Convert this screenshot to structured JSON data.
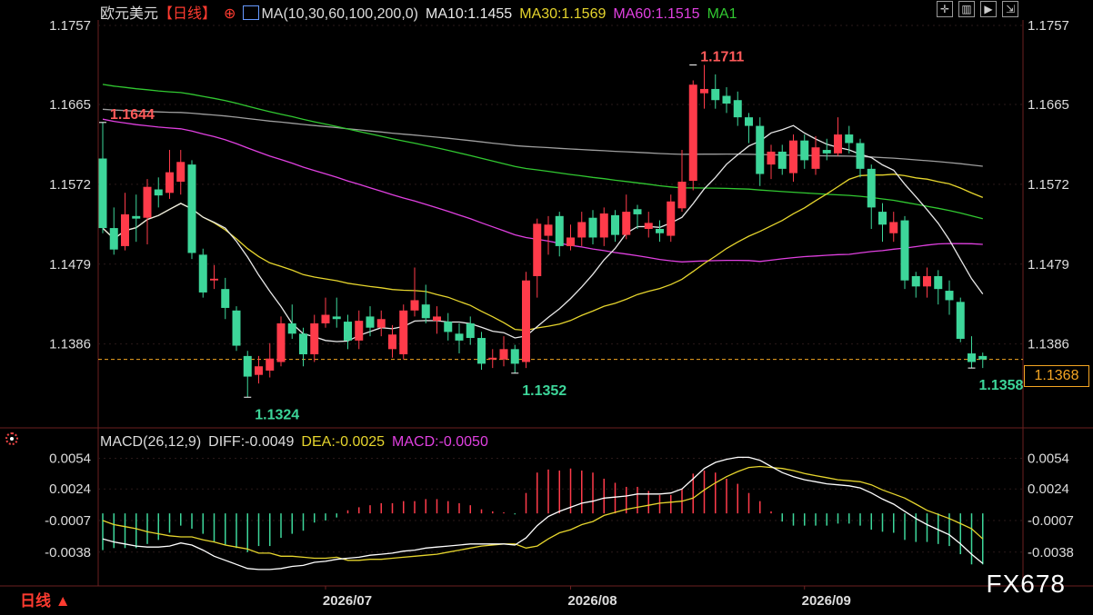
{
  "header": {
    "symbol": "欧元美元",
    "period": "【日线】",
    "add_icon": "⊕",
    "ma_params": "MA(10,30,60,100,200,0)",
    "ma10": "MA10:1.1455",
    "ma30": "MA30:1.1569",
    "ma60": "MA60:1.1515",
    "ma100": "MA1"
  },
  "macd_header": {
    "params": "MACD(26,12,9)",
    "diff": "DIFF:-0.0049",
    "dea": "DEA:-0.0025",
    "macd": "MACD:-0.0050"
  },
  "period_button": "日线 ▲",
  "brand": "FX678",
  "current_price_tag": "1.1368",
  "colors": {
    "up": "#ff3b4a",
    "down": "#3dd69a",
    "ma10": "#e8e8e8",
    "ma30": "#e6d52d",
    "ma60": "#e040e0",
    "ma100": "#31c831",
    "ma200": "#9e9e9e",
    "diff": "#ffffff",
    "dea": "#e6d52d",
    "current_line": "#f5a623"
  },
  "chart_data": [
    {
      "type": "candlestick",
      "title": "欧元美元 日线",
      "yticks": [
        "1.1757",
        "1.1665",
        "1.1572",
        "1.1479",
        "1.1386"
      ],
      "ylim": [
        1.13,
        1.1757
      ],
      "xticks": [
        "2026/07",
        "2026/08",
        "2026/09"
      ],
      "current_price": 1.1368,
      "annotations": [
        {
          "label": "1.1644",
          "candle": 0,
          "value": 1.1644,
          "side": "high"
        },
        {
          "label": "1.1324",
          "candle": 13,
          "value": 1.1324,
          "side": "low"
        },
        {
          "label": "1.1352",
          "candle": 37,
          "value": 1.1352,
          "side": "low"
        },
        {
          "label": "1.1711",
          "candle": 53,
          "value": 1.1711,
          "side": "high"
        },
        {
          "label": "1.1358",
          "candle": 78,
          "value": 1.1358,
          "side": "low"
        }
      ],
      "candles": [
        [
          1.1602,
          1.1521,
          1.1644,
          1.1515
        ],
        [
          1.1521,
          1.1496,
          1.1545,
          1.149
        ],
        [
          1.15,
          1.1537,
          1.1562,
          1.1495
        ],
        [
          1.1535,
          1.1532,
          1.156,
          1.1505
        ],
        [
          1.1533,
          1.1569,
          1.1578,
          1.1502
        ],
        [
          1.1566,
          1.1559,
          1.158,
          1.1545
        ],
        [
          1.1562,
          1.1586,
          1.1612,
          1.1555
        ],
        [
          1.1575,
          1.1598,
          1.1612,
          1.156
        ],
        [
          1.1595,
          1.1492,
          1.16,
          1.1485
        ],
        [
          1.149,
          1.1446,
          1.1497,
          1.144
        ],
        [
          1.146,
          1.1462,
          1.1478,
          1.145
        ],
        [
          1.145,
          1.1428,
          1.1463,
          1.1415
        ],
        [
          1.1425,
          1.1384,
          1.143,
          1.1378
        ],
        [
          1.1372,
          1.1348,
          1.1378,
          1.1324
        ],
        [
          1.135,
          1.136,
          1.1372,
          1.134
        ],
        [
          1.1355,
          1.1369,
          1.1387,
          1.1347
        ],
        [
          1.1365,
          1.141,
          1.1418,
          1.136
        ],
        [
          1.141,
          1.1398,
          1.1432,
          1.1392
        ],
        [
          1.1398,
          1.1374,
          1.1405,
          1.136
        ],
        [
          1.1374,
          1.141,
          1.142,
          1.1365
        ],
        [
          1.141,
          1.142,
          1.144,
          1.1405
        ],
        [
          1.1418,
          1.1415,
          1.144,
          1.1405
        ],
        [
          1.1412,
          1.139,
          1.142,
          1.138
        ],
        [
          1.139,
          1.1413,
          1.1425,
          1.138
        ],
        [
          1.1418,
          1.1405,
          1.143,
          1.1395
        ],
        [
          1.1405,
          1.1415,
          1.1425,
          1.1395
        ],
        [
          1.138,
          1.1397,
          1.1408,
          1.137
        ],
        [
          1.1374,
          1.1425,
          1.1432,
          1.1368
        ],
        [
          1.1425,
          1.1437,
          1.1475,
          1.1418
        ],
        [
          1.1432,
          1.1416,
          1.1455,
          1.141
        ],
        [
          1.1413,
          1.1418,
          1.143,
          1.1398
        ],
        [
          1.1412,
          1.14,
          1.1422,
          1.139
        ],
        [
          1.1398,
          1.139,
          1.141,
          1.1375
        ],
        [
          1.141,
          1.1393,
          1.1418,
          1.1385
        ],
        [
          1.1393,
          1.1363,
          1.14,
          1.1356
        ],
        [
          1.1368,
          1.137,
          1.138,
          1.1358
        ],
        [
          1.1368,
          1.138,
          1.1395,
          1.136
        ],
        [
          1.138,
          1.1363,
          1.1385,
          1.1352
        ],
        [
          1.1365,
          1.146,
          1.147,
          1.1358
        ],
        [
          1.1465,
          1.1526,
          1.1532,
          1.144
        ],
        [
          1.1512,
          1.1525,
          1.1535,
          1.149
        ],
        [
          1.1535,
          1.15,
          1.154,
          1.1488
        ],
        [
          1.15,
          1.151,
          1.1525,
          1.1495
        ],
        [
          1.151,
          1.1528,
          1.154,
          1.15
        ],
        [
          1.1533,
          1.151,
          1.1542,
          1.1502
        ],
        [
          1.151,
          1.1538,
          1.1545,
          1.15
        ],
        [
          1.1536,
          1.1513,
          1.1542,
          1.1505
        ],
        [
          1.1513,
          1.154,
          1.156,
          1.1508
        ],
        [
          1.1543,
          1.1537,
          1.1548,
          1.152
        ],
        [
          1.152,
          1.1527,
          1.154,
          1.151
        ],
        [
          1.152,
          1.1515,
          1.153,
          1.1505
        ],
        [
          1.1512,
          1.1552,
          1.156,
          1.1505
        ],
        [
          1.1544,
          1.1575,
          1.1612,
          1.154
        ],
        [
          1.1576,
          1.1688,
          1.1693,
          1.1565
        ],
        [
          1.1678,
          1.1683,
          1.1711,
          1.166
        ],
        [
          1.1683,
          1.167,
          1.17,
          1.166
        ],
        [
          1.1675,
          1.1666,
          1.1685,
          1.1655
        ],
        [
          1.167,
          1.165,
          1.168,
          1.164
        ],
        [
          1.165,
          1.164,
          1.1655,
          1.162
        ],
        [
          1.164,
          1.1584,
          1.165,
          1.157
        ],
        [
          1.1595,
          1.161,
          1.1618,
          1.1578
        ],
        [
          1.161,
          1.159,
          1.1618,
          1.1583
        ],
        [
          1.1585,
          1.1623,
          1.163,
          1.1575
        ],
        [
          1.1623,
          1.16,
          1.163,
          1.159
        ],
        [
          1.159,
          1.1615,
          1.1628,
          1.1583
        ],
        [
          1.1612,
          1.1608,
          1.1625,
          1.16
        ],
        [
          1.1608,
          1.163,
          1.165,
          1.1605
        ],
        [
          1.163,
          1.162,
          1.164,
          1.1608
        ],
        [
          1.162,
          1.159,
          1.1625,
          1.158
        ],
        [
          1.159,
          1.1545,
          1.1595,
          1.152
        ],
        [
          1.154,
          1.1525,
          1.155,
          1.1505
        ],
        [
          1.1515,
          1.1528,
          1.154,
          1.1505
        ],
        [
          1.153,
          1.146,
          1.1535,
          1.145
        ],
        [
          1.1465,
          1.1453,
          1.147,
          1.144
        ],
        [
          1.1453,
          1.1465,
          1.1475,
          1.144
        ],
        [
          1.1465,
          1.145,
          1.1472,
          1.1432
        ],
        [
          1.1448,
          1.1437,
          1.146,
          1.142
        ],
        [
          1.1435,
          1.1392,
          1.144,
          1.1388
        ],
        [
          1.1375,
          1.1365,
          1.1395,
          1.1358
        ],
        [
          1.1372,
          1.1368,
          1.1376,
          1.1358
        ]
      ]
    },
    {
      "type": "bar",
      "title": "MACD(26,12,9)",
      "yticks": [
        "0.0054",
        "0.0024",
        "-0.0007",
        "-0.0038"
      ],
      "ylim": [
        -0.0055,
        0.006
      ],
      "series": [
        {
          "name": "MACD",
          "values": [
            -0.0036,
            -0.0034,
            -0.0034,
            -0.0034,
            -0.003,
            -0.0026,
            -0.0019,
            -0.0012,
            -0.0015,
            -0.002,
            -0.0028,
            -0.0031,
            -0.0034,
            -0.0038,
            -0.0032,
            -0.0032,
            -0.0024,
            -0.002,
            -0.0017,
            -0.0009,
            -0.0007,
            -0.0004,
            0.0003,
            0.0006,
            0.0008,
            0.001,
            0.001,
            0.0012,
            0.0012,
            0.0014,
            0.0014,
            0.0012,
            0.001,
            0.0008,
            0.0004,
            0.0002,
            0.0001,
            -0.0001,
            0.002,
            0.004,
            0.0043,
            0.0042,
            0.0044,
            0.0042,
            0.004,
            0.0034,
            0.003,
            0.0026,
            0.0026,
            0.0022,
            0.0018,
            0.0018,
            0.0024,
            0.0039,
            0.0042,
            0.004,
            0.0034,
            0.0029,
            0.002,
            0.0012,
            0.0002,
            -0.0008,
            -0.0012,
            -0.0012,
            -0.0012,
            -0.0012,
            -0.001,
            -0.001,
            -0.0012,
            -0.0016,
            -0.0018,
            -0.0019,
            -0.0026,
            -0.0028,
            -0.0028,
            -0.003,
            -0.0032,
            -0.004,
            -0.005,
            -0.005
          ]
        },
        {
          "name": "DIFF",
          "values": [
            -0.0025,
            -0.0028,
            -0.003,
            -0.0032,
            -0.0033,
            -0.0033,
            -0.0032,
            -0.0029,
            -0.0031,
            -0.0036,
            -0.0042,
            -0.0046,
            -0.005,
            -0.0054,
            -0.0055,
            -0.0055,
            -0.0054,
            -0.0052,
            -0.0051,
            -0.0048,
            -0.0047,
            -0.0045,
            -0.0044,
            -0.0043,
            -0.0041,
            -0.004,
            -0.0039,
            -0.0037,
            -0.0036,
            -0.0034,
            -0.0033,
            -0.0032,
            -0.0031,
            -0.003,
            -0.003,
            -0.003,
            -0.003,
            -0.0031,
            -0.0024,
            -0.0012,
            -0.0003,
            0.0002,
            0.0006,
            0.001,
            0.0012,
            0.0015,
            0.0016,
            0.0017,
            0.0019,
            0.0019,
            0.0019,
            0.002,
            0.0024,
            0.0034,
            0.0044,
            0.005,
            0.0053,
            0.0055,
            0.0055,
            0.0052,
            0.0046,
            0.004,
            0.0036,
            0.0033,
            0.0031,
            0.0029,
            0.0028,
            0.0027,
            0.0025,
            0.002,
            0.0014,
            0.0009,
            0.0002,
            -0.0005,
            -0.0011,
            -0.0016,
            -0.0021,
            -0.003,
            -0.004,
            -0.0049
          ]
        },
        {
          "name": "DEA",
          "values": [
            -0.0007,
            -0.0011,
            -0.0013,
            -0.0015,
            -0.0018,
            -0.002,
            -0.0022,
            -0.0023,
            -0.0023,
            -0.0026,
            -0.0028,
            -0.0031,
            -0.0033,
            -0.0035,
            -0.0039,
            -0.0039,
            -0.0042,
            -0.0042,
            -0.0043,
            -0.0044,
            -0.0044,
            -0.0043,
            -0.0046,
            -0.0046,
            -0.0045,
            -0.0045,
            -0.0044,
            -0.0043,
            -0.0042,
            -0.0041,
            -0.004,
            -0.0038,
            -0.0036,
            -0.0034,
            -0.0032,
            -0.0031,
            -0.003,
            -0.003,
            -0.0034,
            -0.0032,
            -0.0025,
            -0.0019,
            -0.0016,
            -0.0011,
            -0.0008,
            -0.0002,
            0.0001,
            0.0004,
            0.0006,
            0.0008,
            0.001,
            0.0011,
            0.0012,
            0.0015,
            0.0023,
            0.003,
            0.0036,
            0.0041,
            0.0045,
            0.0046,
            0.0045,
            0.0044,
            0.0042,
            0.0039,
            0.0037,
            0.0035,
            0.0033,
            0.0032,
            0.0031,
            0.0028,
            0.0023,
            0.0019,
            0.0015,
            0.0009,
            0.0003,
            -0.0001,
            -0.0005,
            -0.001,
            -0.0015,
            -0.0025
          ]
        }
      ]
    }
  ]
}
